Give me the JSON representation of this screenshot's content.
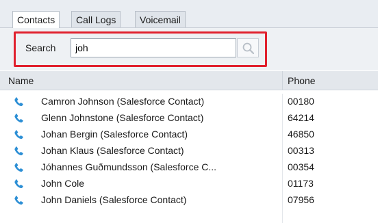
{
  "tabs": [
    {
      "label": "Contacts",
      "active": true
    },
    {
      "label": "Call Logs",
      "active": false
    },
    {
      "label": "Voicemail",
      "active": false
    }
  ],
  "search": {
    "label": "Search",
    "value": "joh",
    "highlight_color": "#e0202d"
  },
  "table": {
    "columns": [
      "Name",
      "Phone"
    ],
    "rows": [
      {
        "name": "Camron Johnson (Salesforce Contact)",
        "phone": "00180"
      },
      {
        "name": "Glenn Johnstone (Salesforce Contact)",
        "phone": "64214"
      },
      {
        "name": "Johan Bergin (Salesforce Contact)",
        "phone": "46850"
      },
      {
        "name": "Johan Klaus (Salesforce Contact)",
        "phone": "00313"
      },
      {
        "name": "Jóhannes Guðmundsson (Salesforce C...",
        "phone": "00354"
      },
      {
        "name": "John Cole",
        "phone": "01173"
      },
      {
        "name": "John Daniels (Salesforce Contact)",
        "phone": "07956"
      }
    ],
    "row_icon": "phone-icon",
    "icon_color": "#2d8fd5"
  }
}
